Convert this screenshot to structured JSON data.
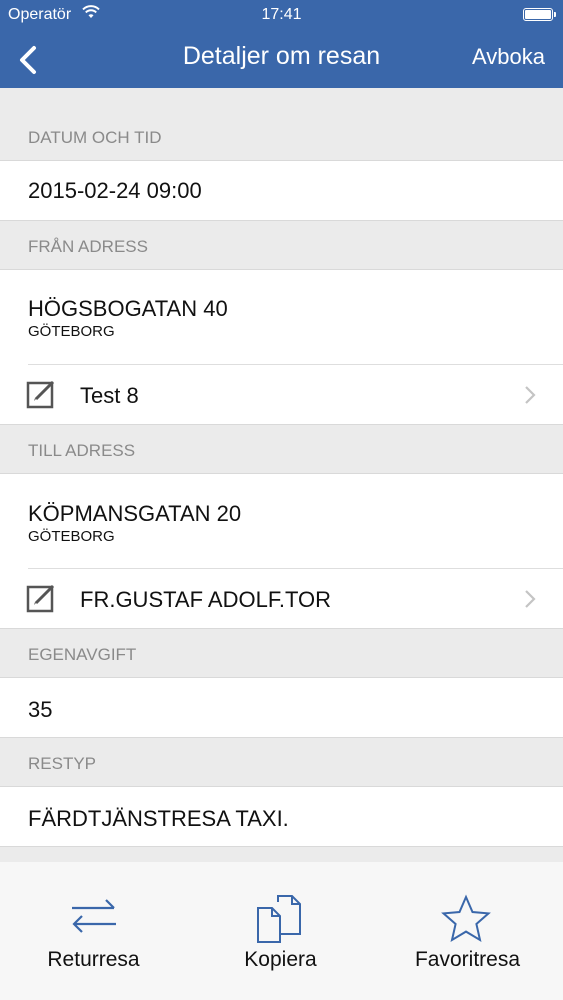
{
  "status_bar": {
    "carrier": "Operatör",
    "time": "17:41"
  },
  "nav": {
    "title": "Detaljer om resan",
    "action": "Avboka"
  },
  "sections": {
    "datum": {
      "header": "DATUM OCH TID",
      "value": "2015-02-24 09:00"
    },
    "fran": {
      "header": "FRÅN ADRESS",
      "street": "HÖGSBOGATAN 40",
      "city": "GÖTEBORG",
      "note": "Test 8"
    },
    "till": {
      "header": "TILL ADRESS",
      "street": "KÖPMANSGATAN 20",
      "city": "GÖTEBORG",
      "note": "FR.GUSTAF ADOLF.TOR"
    },
    "egenavgift": {
      "header": "EGENAVGIFT",
      "value": "35"
    },
    "restyp": {
      "header": "RESTYP",
      "value": "FÄRDTJÄNSTRESA TAXI."
    }
  },
  "tabbar": [
    {
      "label": "Returresa",
      "icon": "swap-arrows-icon"
    },
    {
      "label": "Kopiera",
      "icon": "copy-icon"
    },
    {
      "label": "Favoritresa",
      "icon": "star-icon"
    }
  ],
  "colors": {
    "nav_bg": "#3a67aa",
    "icon_blue": "#3a67aa",
    "section_bg": "#ebebeb"
  }
}
